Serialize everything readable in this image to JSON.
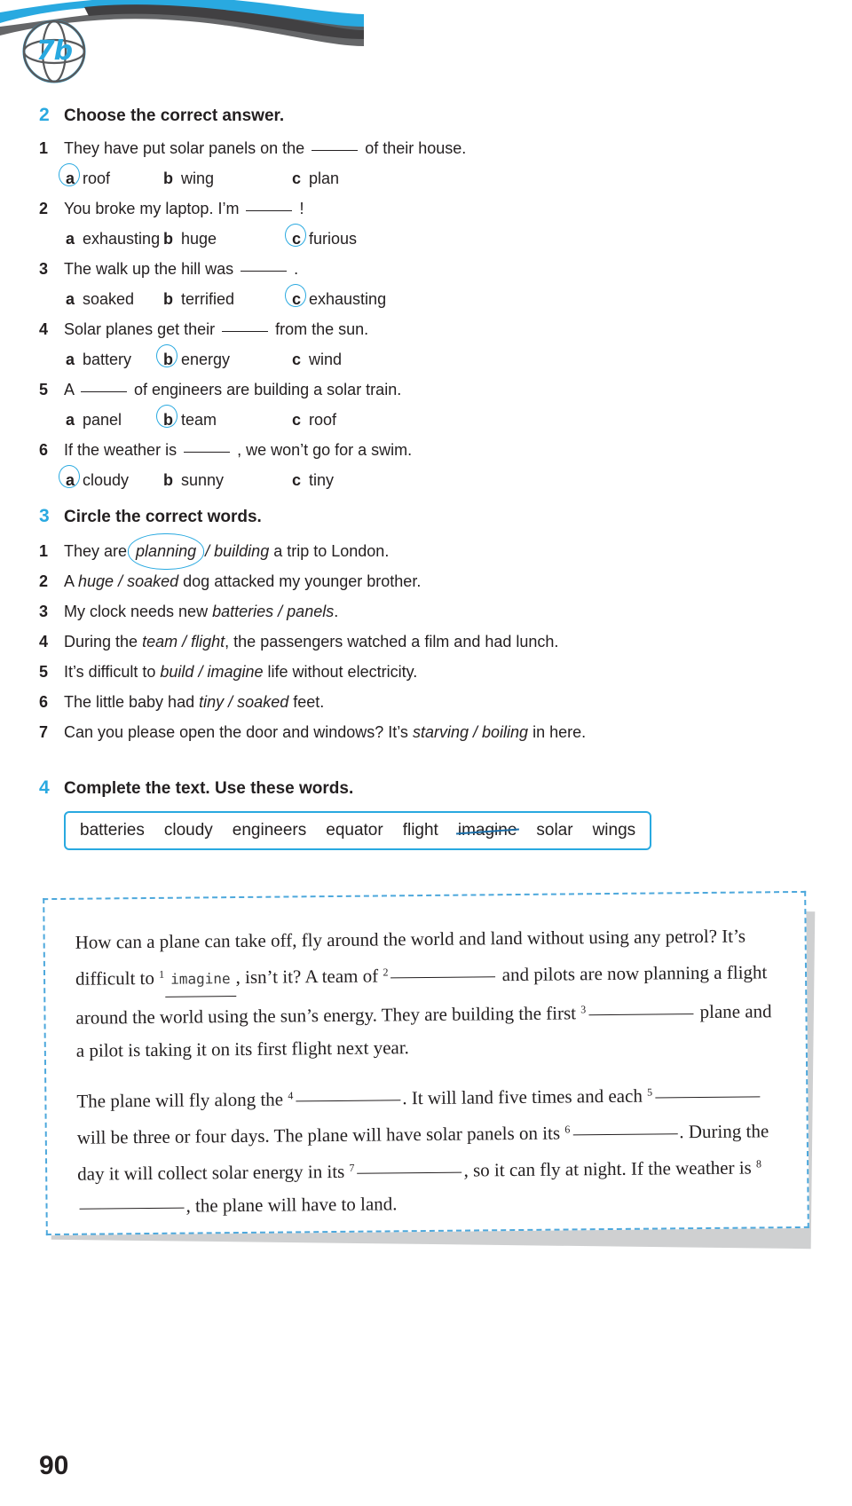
{
  "unit_badge": "7b",
  "page_number": "90",
  "colors": {
    "accent": "#29a9e0",
    "text": "#231f20",
    "dashed_border": "#4da8dc"
  },
  "exercise2": {
    "number": "2",
    "title": "Choose the correct answer.",
    "items": [
      {
        "num": "1",
        "pre": "They have put solar panels on the",
        "post": "of their house.",
        "options": [
          {
            "letter": "a",
            "word": "roof",
            "selected": true
          },
          {
            "letter": "b",
            "word": "wing",
            "selected": false
          },
          {
            "letter": "c",
            "word": "plan",
            "selected": false
          }
        ]
      },
      {
        "num": "2",
        "pre": "You broke my laptop. I’m",
        "post": "!",
        "options": [
          {
            "letter": "a",
            "word": "exhausting",
            "selected": false
          },
          {
            "letter": "b",
            "word": "huge",
            "selected": false
          },
          {
            "letter": "c",
            "word": "furious",
            "selected": true
          }
        ]
      },
      {
        "num": "3",
        "pre": "The walk up the hill was",
        "post": ".",
        "options": [
          {
            "letter": "a",
            "word": "soaked",
            "selected": false
          },
          {
            "letter": "b",
            "word": "terrified",
            "selected": false
          },
          {
            "letter": "c",
            "word": "exhausting",
            "selected": true
          }
        ]
      },
      {
        "num": "4",
        "pre": "Solar planes get their",
        "post": "from the sun.",
        "options": [
          {
            "letter": "a",
            "word": "battery",
            "selected": false
          },
          {
            "letter": "b",
            "word": "energy",
            "selected": true
          },
          {
            "letter": "c",
            "word": "wind",
            "selected": false
          }
        ]
      },
      {
        "num": "5",
        "pre": "A",
        "post": "of engineers are building a solar train.",
        "options": [
          {
            "letter": "a",
            "word": "panel",
            "selected": false
          },
          {
            "letter": "b",
            "word": "team",
            "selected": true
          },
          {
            "letter": "c",
            "word": "roof",
            "selected": false
          }
        ]
      },
      {
        "num": "6",
        "pre": "If the weather is",
        "post": ", we won’t go for a swim.",
        "options": [
          {
            "letter": "a",
            "word": "cloudy",
            "selected": true
          },
          {
            "letter": "b",
            "word": "sunny",
            "selected": false
          },
          {
            "letter": "c",
            "word": "tiny",
            "selected": false
          }
        ]
      }
    ]
  },
  "exercise3": {
    "number": "3",
    "title": "Circle the correct words.",
    "items": [
      {
        "num": "1",
        "pre": "They are",
        "w1": "planning",
        "w2": "building",
        "post": "a trip to London.",
        "circled": 1
      },
      {
        "num": "2",
        "pre": "A",
        "w1": "huge",
        "w2": "soaked",
        "post": "dog attacked my younger brother.",
        "circled": 0
      },
      {
        "num": "3",
        "pre": "My clock needs new",
        "w1": "batteries",
        "w2": "panels",
        "post": ".",
        "circled": 0
      },
      {
        "num": "4",
        "pre": "During the",
        "w1": "team",
        "w2": "flight",
        "post": ", the passengers watched a film and had lunch.",
        "circled": 0
      },
      {
        "num": "5",
        "pre": "It’s difficult to",
        "w1": "build",
        "w2": "imagine",
        "post": "life without electricity.",
        "circled": 0
      },
      {
        "num": "6",
        "pre": "The little baby had",
        "w1": "tiny",
        "w2": "soaked",
        "post": "feet.",
        "circled": 0
      },
      {
        "num": "7",
        "pre": "Can you please open the door and windows? It’s",
        "w1": "starving",
        "w2": "boiling",
        "post": "in here.",
        "circled": 0
      }
    ]
  },
  "exercise4": {
    "number": "4",
    "title": "Complete the text. Use these words.",
    "wordbank": [
      {
        "word": "batteries",
        "used": false
      },
      {
        "word": "cloudy",
        "used": false
      },
      {
        "word": "engineers",
        "used": false
      },
      {
        "word": "equator",
        "used": false
      },
      {
        "word": "flight",
        "used": false
      },
      {
        "word": "imagine",
        "used": true
      },
      {
        "word": "solar",
        "used": false
      },
      {
        "word": "wings",
        "used": false
      }
    ],
    "text": {
      "p1_a": "How can a plane can take off, fly around the world and land without using any petrol? It’s difficult to",
      "answer1": "imagine",
      "p1_b": ", isn’t it? A team of",
      "p1_c": "and pilots are now planning a flight around the world using the sun’s energy. They are building the first",
      "p1_d": "plane and a pilot is taking it on its first flight next year.",
      "p2_a": "The plane will fly along the",
      "p2_b": ". It will land five times and each",
      "p2_c": "will be three or four days. The plane will have solar panels on its",
      "p2_d": ". During the day it will collect solar energy in its",
      "p2_e": ", so it can fly at night. If the weather is",
      "p2_f": ", the plane will have to land.",
      "numbers": [
        "1",
        "2",
        "3",
        "4",
        "5",
        "6",
        "7",
        "8"
      ]
    }
  }
}
